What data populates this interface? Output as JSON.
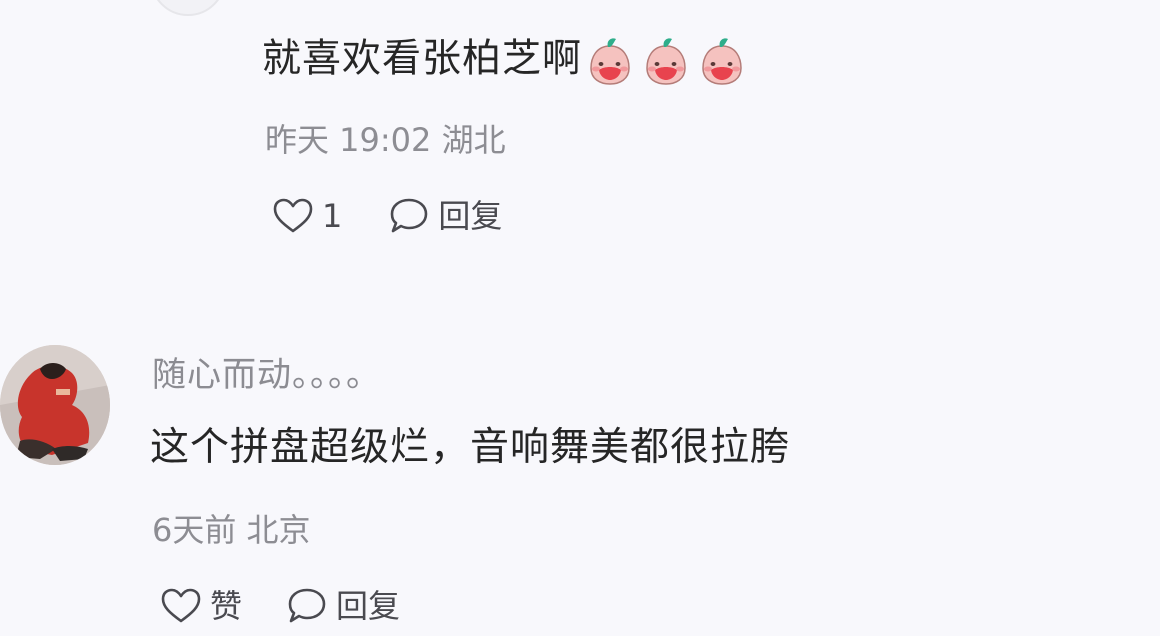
{
  "comments": [
    {
      "text": "就喜欢看张柏芝啊",
      "emoji_count": 3,
      "emoji_icon": "blushing-peach-emoji-icon",
      "meta": "昨天 19:02 湖北",
      "like_count": "1",
      "reply_label": "回复"
    },
    {
      "username": "随心而动。。。。",
      "text": "这个拼盘超级烂，音响舞美都很拉胯",
      "meta": "6天前 北京",
      "like_label": "赞",
      "reply_label": "回复"
    }
  ],
  "icons": {
    "like": "heart-outline-icon",
    "reply": "speech-bubble-icon"
  },
  "colors": {
    "background": "#f8f8fc",
    "text": "#262626",
    "meta": "#8d8d93",
    "emoji_pink": "#f3b7b4",
    "emoji_red": "#e8434e",
    "emoji_green": "#2fae8b"
  }
}
